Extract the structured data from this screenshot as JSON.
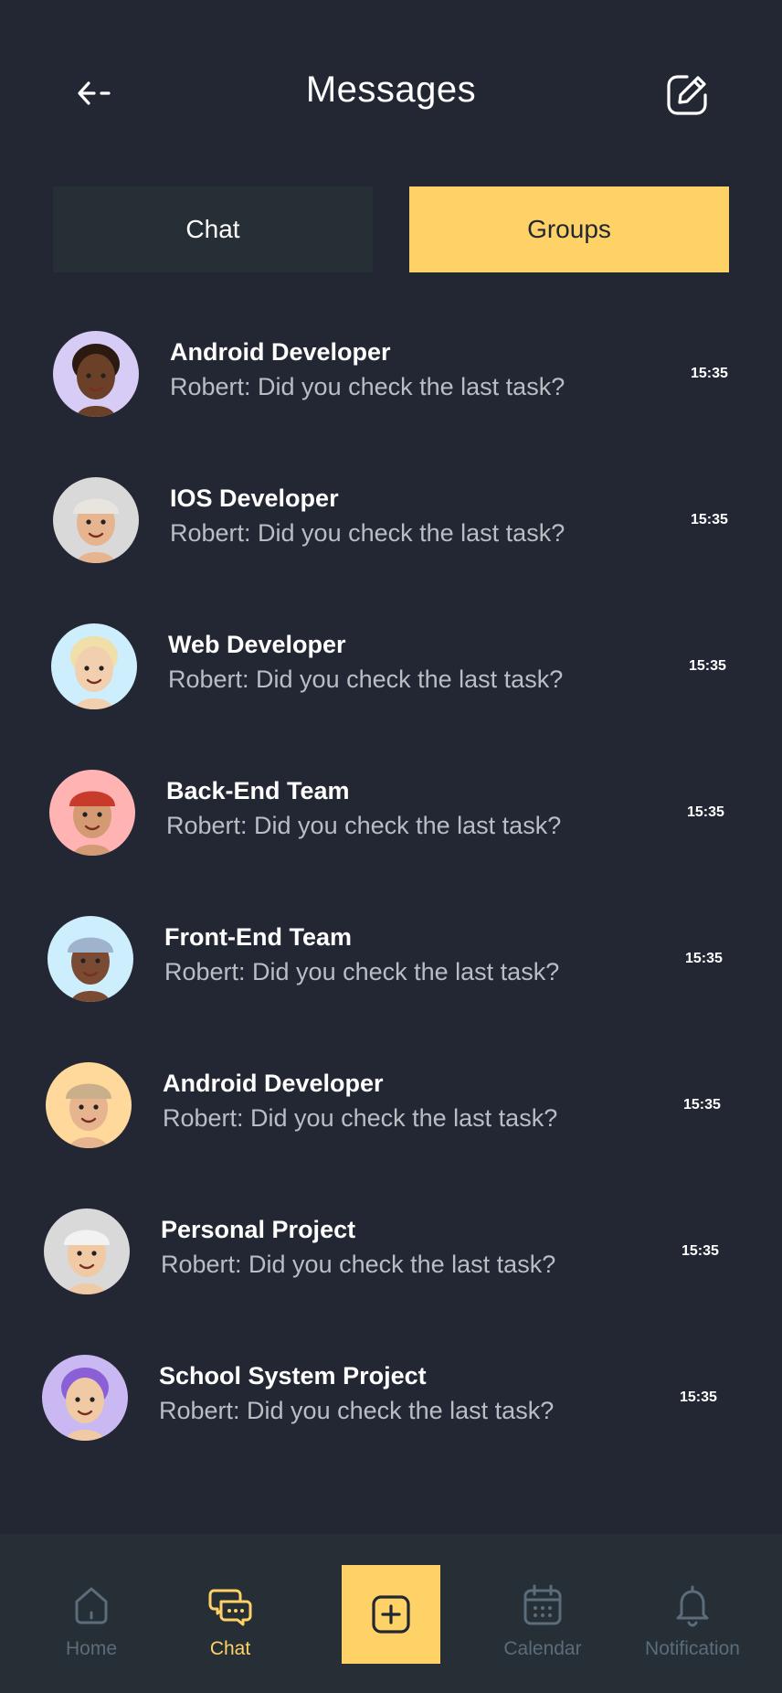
{
  "header": {
    "title": "Messages"
  },
  "tabs": [
    {
      "label": "Chat",
      "active": false
    },
    {
      "label": "Groups",
      "active": true
    }
  ],
  "groups": [
    {
      "name": "Android Developer",
      "message": "Robert: Did you check the last task?",
      "time": "15:35",
      "avatar_bg": "#d7ccf5",
      "avatar": "memoji-dark-skin"
    },
    {
      "name": "IOS Developer",
      "message": "Robert: Did you check the last task?",
      "time": "15:35",
      "avatar_bg": "#d9d9d9",
      "avatar": "memoji-beanie-tongue"
    },
    {
      "name": "Web Developer",
      "message": "Robert: Did you check the last task?",
      "time": "15:35",
      "avatar_bg": "#cdeefc",
      "avatar": "memoji-blonde-wink"
    },
    {
      "name": "Back-End Team",
      "message": "Robert: Did you check the last task?",
      "time": "15:35",
      "avatar_bg": "#ffb3b3",
      "avatar": "memoji-turban-beard"
    },
    {
      "name": "Front-End Team",
      "message": "Robert: Did you check the last task?",
      "time": "15:35",
      "avatar_bg": "#cdeefc",
      "avatar": "memoji-knit-hat"
    },
    {
      "name": "Android Developer",
      "message": "Robert: Did you check the last task?",
      "time": "15:35",
      "avatar_bg": "#ffd89b",
      "avatar": "memoji-cowboy-hat"
    },
    {
      "name": "Personal Project",
      "message": "Robert: Did you check the last task?",
      "time": "15:35",
      "avatar_bg": "#d9d9d9",
      "avatar": "memoji-white-beanie"
    },
    {
      "name": "School System Project",
      "message": "Robert: Did you check the last task?",
      "time": "15:35",
      "avatar_bg": "#c9b8f2",
      "avatar": "memoji-purple-hair"
    }
  ],
  "nav": [
    {
      "label": "Home",
      "icon": "home-icon",
      "active": false
    },
    {
      "label": "Chat",
      "icon": "chat-icon",
      "active": true
    },
    {
      "label": "Calendar",
      "icon": "calendar-icon",
      "active": false
    },
    {
      "label": "Notification",
      "icon": "bell-icon",
      "active": false
    }
  ],
  "colors": {
    "background": "#222733",
    "accent": "#ffd268",
    "surface": "#262e36",
    "muted": "#5b6c7a"
  }
}
